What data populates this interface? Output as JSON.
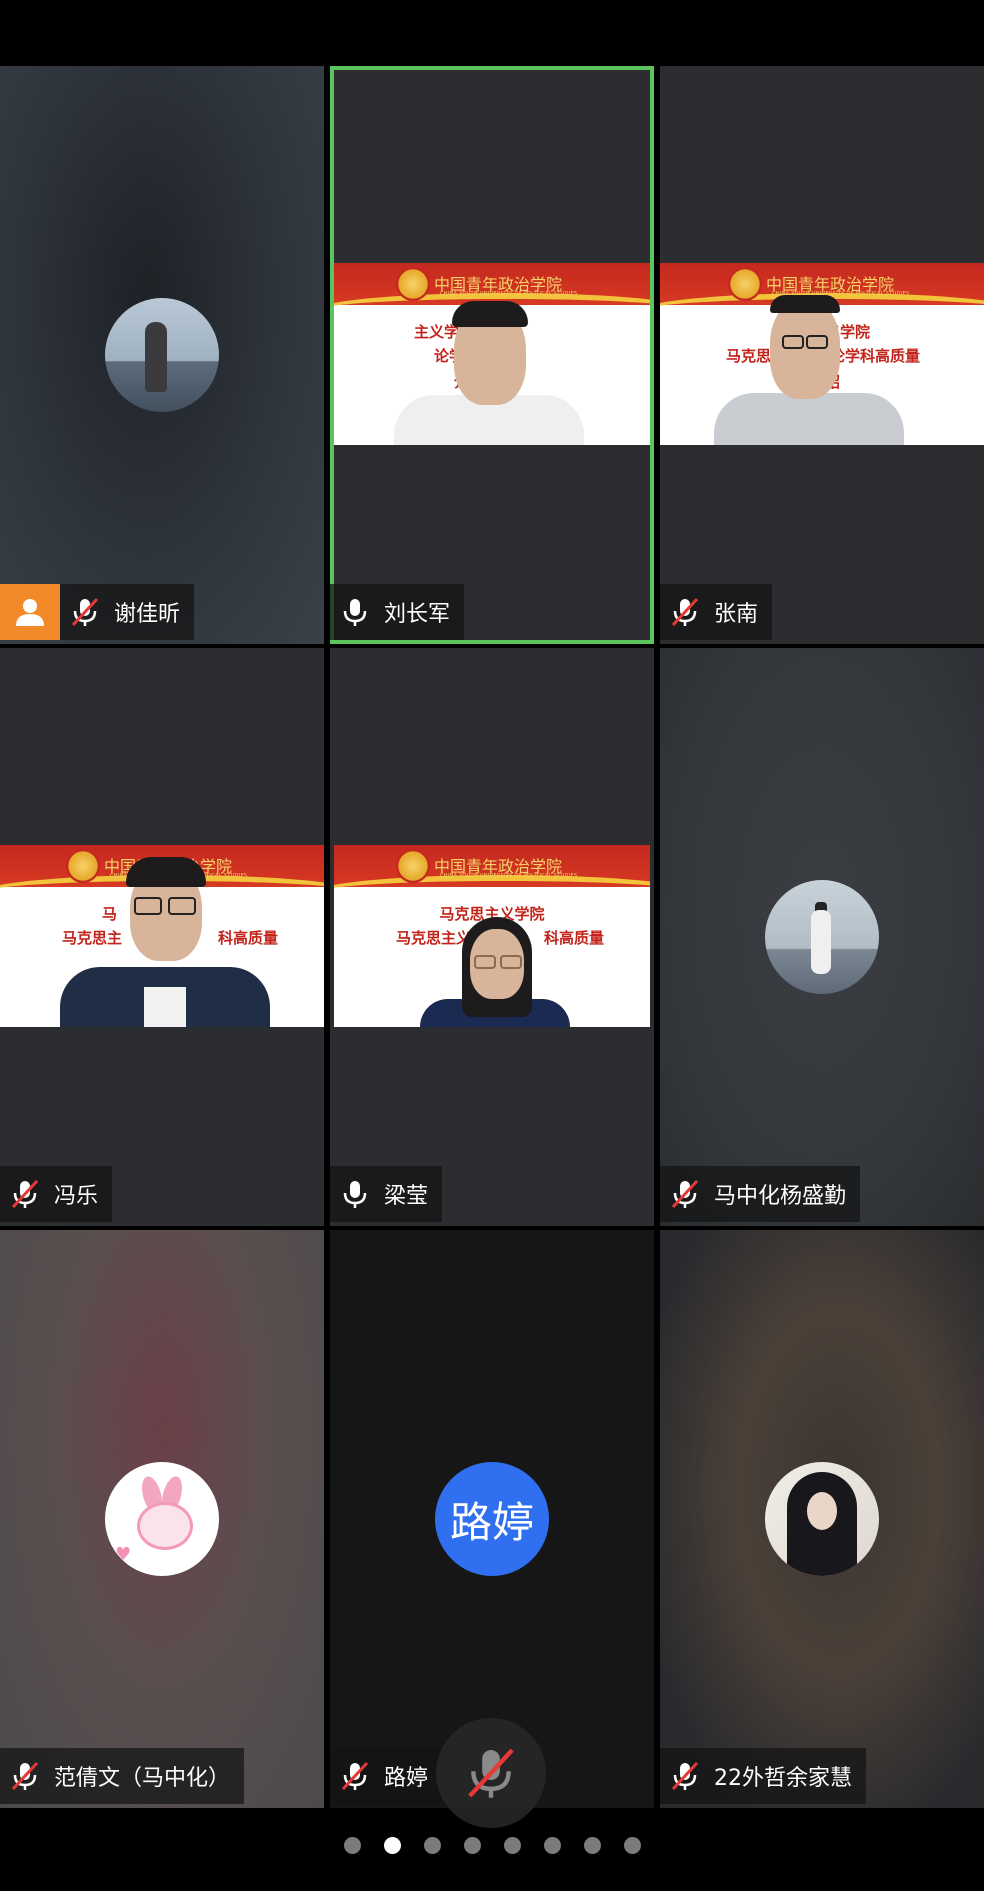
{
  "participants": [
    {
      "name": "谢佳昕",
      "mic": "muted",
      "host": true,
      "tile": "avatar"
    },
    {
      "name": "刘长军",
      "mic": "on",
      "active": true,
      "tile": "video"
    },
    {
      "name": "张南",
      "mic": "muted",
      "tile": "video"
    },
    {
      "name": "冯乐",
      "mic": "muted",
      "tile": "video"
    },
    {
      "name": "梁莹",
      "mic": "on",
      "tile": "video"
    },
    {
      "name": "马中化杨盛勤",
      "mic": "muted",
      "tile": "avatar"
    },
    {
      "name": "范倩文（马中化）",
      "mic": "muted",
      "tile": "avatar"
    },
    {
      "name": "路婷",
      "mic": "muted",
      "tile": "text-avatar",
      "avatar_text": "路婷"
    },
    {
      "name": "22外哲余家慧",
      "mic": "muted",
      "tile": "avatar"
    }
  ],
  "slide": {
    "logo_text": "中国青年政治学院",
    "logo_sub": "CHINA YOUTH UNIVERSITY OF POLITICAL STUDIES",
    "tile2_lines": [
      "主义学院",
      "马克思",
      "论学科高质量",
      "介绍"
    ],
    "tile3_lines": [
      "主义学院",
      "马克思",
      "论学科高质量",
      "介绍"
    ],
    "tile4_lines": [
      "马",
      "马克思主",
      "科高质量"
    ],
    "tile5_lines": [
      "马克思主义学院",
      "马克思主义",
      "科高质量"
    ]
  },
  "pagination": {
    "total": 8,
    "current": 2
  },
  "colors": {
    "active_border": "#5cc45f",
    "host_badge": "#f28a2a",
    "avatar_blue": "#2f6ff0",
    "muted_slash": "#e53935"
  }
}
